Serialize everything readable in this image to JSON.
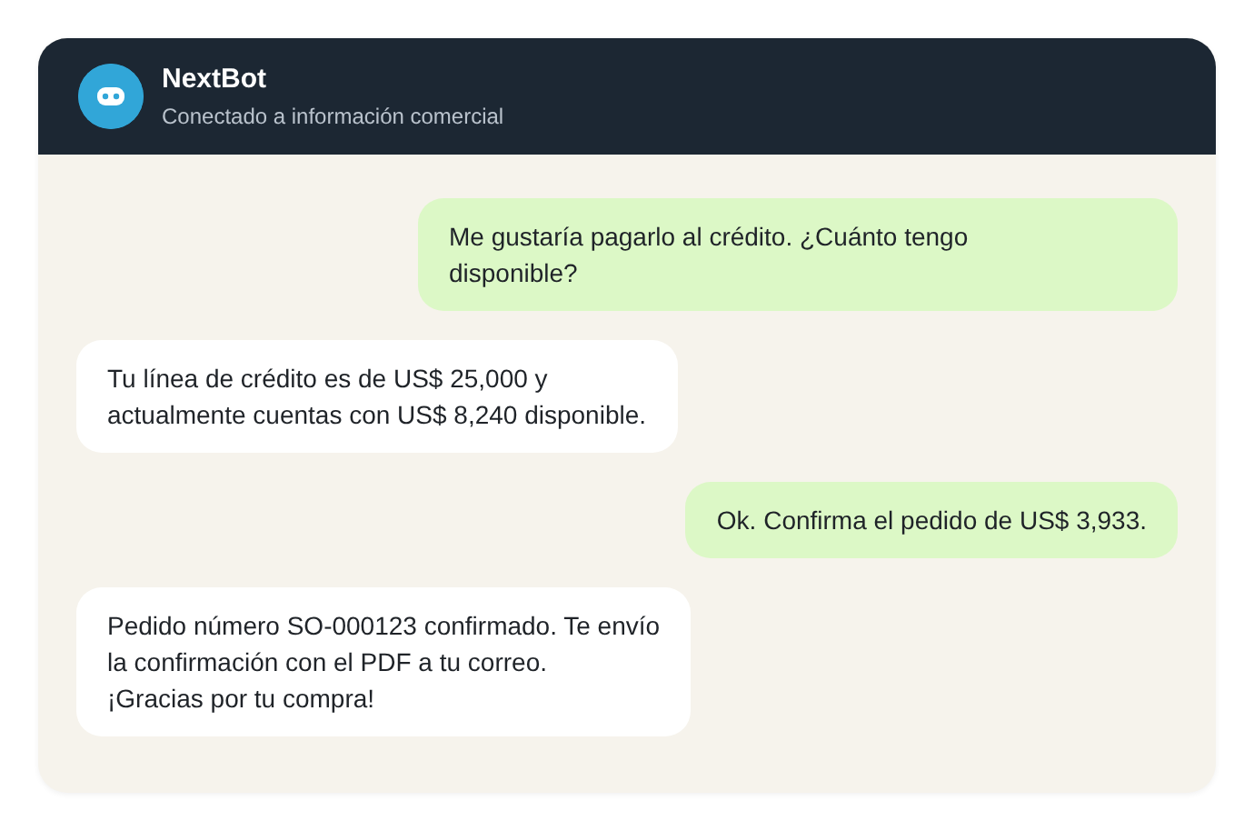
{
  "header": {
    "title": "NextBot",
    "subtitle": "Conectado a información comercial"
  },
  "messages": [
    {
      "kind": "user",
      "text": "Me gustaría pagarlo al crédito. ¿Cuánto tengo\ndisponible?"
    },
    {
      "kind": "bot",
      "text": "Tu línea de crédito es de US$ 25,000 y\nactualmente cuentas con US$ 8,240 disponible."
    },
    {
      "kind": "user",
      "text": "Ok. Confirma el pedido de US$ 3,933."
    },
    {
      "kind": "bot",
      "text": "Pedido número SO-000123 confirmado. Te envío\nla confirmación con el PDF a tu correo.\n¡Gracias por tu compra!"
    }
  ]
}
